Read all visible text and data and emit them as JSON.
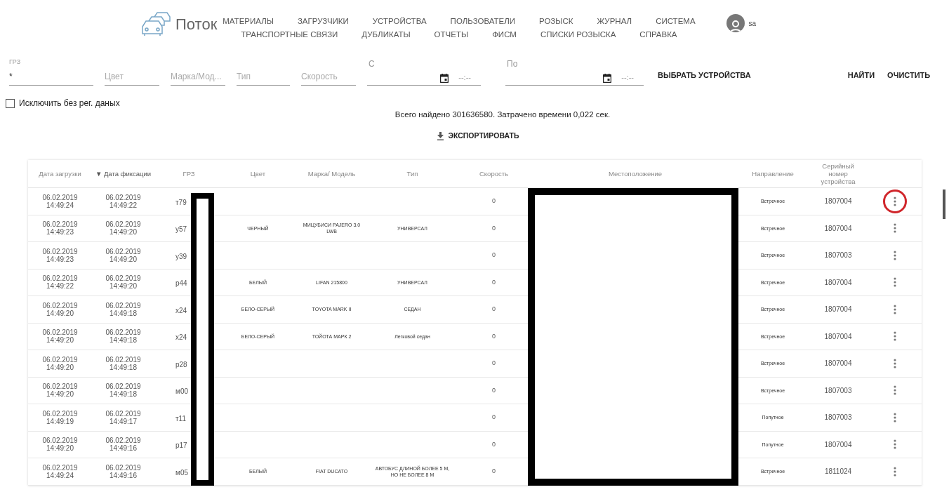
{
  "header": {
    "logo_text": "Поток",
    "nav_rows": [
      [
        "МАТЕРИАЛЫ",
        "ЗАГРУЗЧИКИ",
        "УСТРОЙСТВА",
        "ПОЛЬЗОВАТЕЛИ",
        "РОЗЫСК",
        "ЖУРНАЛ",
        "СИСТЕМА"
      ],
      [
        "ТРАНСПОРТНЫЕ СВЯЗИ",
        "ДУБЛИКАТЫ",
        "ОТЧЕТЫ",
        "ФИСМ",
        "СПИСКИ РОЗЫСКА",
        "СПРАВКА"
      ]
    ],
    "user": {
      "name": "sa"
    }
  },
  "filters": {
    "fields": [
      {
        "kind": "text",
        "label": "ГРЗ",
        "value": "*"
      },
      {
        "kind": "text",
        "placeholder": "Цвет"
      },
      {
        "kind": "text",
        "placeholder": "Марка/Мод..."
      },
      {
        "kind": "text",
        "placeholder": "Тип"
      },
      {
        "kind": "text",
        "placeholder": "Скорость"
      },
      {
        "kind": "datetime",
        "label": "С",
        "time_placeholder": "--:--"
      },
      {
        "kind": "datetime",
        "label": "По",
        "time_placeholder": "--:--"
      }
    ],
    "select_devices": "ВЫБРАТЬ УСТРОЙСТВА",
    "find": "НАЙТИ",
    "clear": "ОЧИСТИТЬ",
    "exclude_checkbox": {
      "label": "Исключить без рег. даных",
      "checked": false
    }
  },
  "summary": "Всего найдено 301636580. Затрачено времени 0,022 сек.",
  "export_button": "ЭКСПОРТИРОВАТЬ",
  "table": {
    "columns": [
      {
        "label": "Дата загрузки",
        "sorted": false
      },
      {
        "label": "Дата фиксации",
        "sorted": true,
        "sort_mark": "▼"
      },
      {
        "label": "ГРЗ",
        "sorted": false
      },
      {
        "label": "Цвет",
        "sorted": false
      },
      {
        "label": "Марка/ Модель",
        "sorted": false
      },
      {
        "label": "Тип",
        "sorted": false
      },
      {
        "label": "Скорость",
        "sorted": false
      },
      {
        "label": "Местоположение",
        "sorted": false
      },
      {
        "label": "Направление",
        "sorted": false
      },
      {
        "label": "Серийный номер устройства",
        "sorted": false
      }
    ],
    "rows": [
      {
        "uploaded": "06.02.2019\n14:49:24",
        "fixed": "06.02.2019\n14:49:22",
        "plate": "т79",
        "speed": "0",
        "direction": "Встречное",
        "serial": "1807004",
        "circled": true
      },
      {
        "uploaded": "06.02.2019\n14:49:23",
        "fixed": "06.02.2019\n14:49:20",
        "plate": "у57",
        "vehicle_color": "ЧЕРНЫЙ",
        "model": "МИЦУБИСИ PAJERO 3.0 LWB",
        "type": "УНИВЕРСАЛ",
        "speed": "0",
        "direction": "Встречное",
        "serial": "1807004",
        "circled": false
      },
      {
        "uploaded": "06.02.2019\n14:49:23",
        "fixed": "06.02.2019\n14:49:20",
        "plate": "у39",
        "speed": "0",
        "direction": "Встречное",
        "serial": "1807003",
        "circled": false
      },
      {
        "uploaded": "06.02.2019\n14:49:22",
        "fixed": "06.02.2019\n14:49:20",
        "plate": "р44",
        "vehicle_color": "БЕЛЫЙ",
        "model": "LIFAN 215800",
        "type": "УНИВЕРСАЛ",
        "speed": "0",
        "direction": "Встречное",
        "serial": "1807004",
        "circled": false
      },
      {
        "uploaded": "06.02.2019\n14:49:20",
        "fixed": "06.02.2019\n14:49:18",
        "plate": "х24",
        "vehicle_color": "БЕЛО-СЕРЫЙ",
        "model": "TOYOTA MARK II",
        "type": "СЕДАН",
        "speed": "0",
        "direction": "Встречное",
        "serial": "1807004",
        "circled": false
      },
      {
        "uploaded": "06.02.2019\n14:49:20",
        "fixed": "06.02.2019\n14:49:18",
        "plate": "х24",
        "vehicle_color": "БЕЛО-СЕРЫЙ",
        "model": "ТОЙОТА МАРК 2",
        "type": "Легковой седан",
        "speed": "0",
        "direction": "Встречное",
        "serial": "1807004",
        "circled": false
      },
      {
        "uploaded": "06.02.2019\n14:49:20",
        "fixed": "06.02.2019\n14:49:18",
        "plate": "р28",
        "speed": "0",
        "direction": "Встречное",
        "serial": "1807004",
        "circled": false
      },
      {
        "uploaded": "06.02.2019\n14:49:20",
        "fixed": "06.02.2019\n14:49:18",
        "plate": "м00",
        "speed": "0",
        "direction": "Встречное",
        "serial": "1807003",
        "circled": false
      },
      {
        "uploaded": "06.02.2019\n14:49:19",
        "fixed": "06.02.2019\n14:49:17",
        "plate": "т11",
        "speed": "0",
        "direction": "Попутное",
        "serial": "1807003",
        "circled": false
      },
      {
        "uploaded": "06.02.2019\n14:49:20",
        "fixed": "06.02.2019\n14:49:16",
        "plate": "р17",
        "speed": "0",
        "direction": "Попутное",
        "serial": "1807004",
        "circled": false
      },
      {
        "uploaded": "06.02.2019\n14:49:24",
        "fixed": "06.02.2019\n14:49:16",
        "plate": "м05",
        "vehicle_color": "БЕЛЫЙ",
        "model": "FIAT DUCATO",
        "type": "АВТОБУС ДЛИНОЙ БОЛЕЕ 5 М, НО НЕ БОЛЕЕ 8 М",
        "speed": "0",
        "direction": "Встречное",
        "serial": "1811024",
        "circled": false
      }
    ]
  }
}
